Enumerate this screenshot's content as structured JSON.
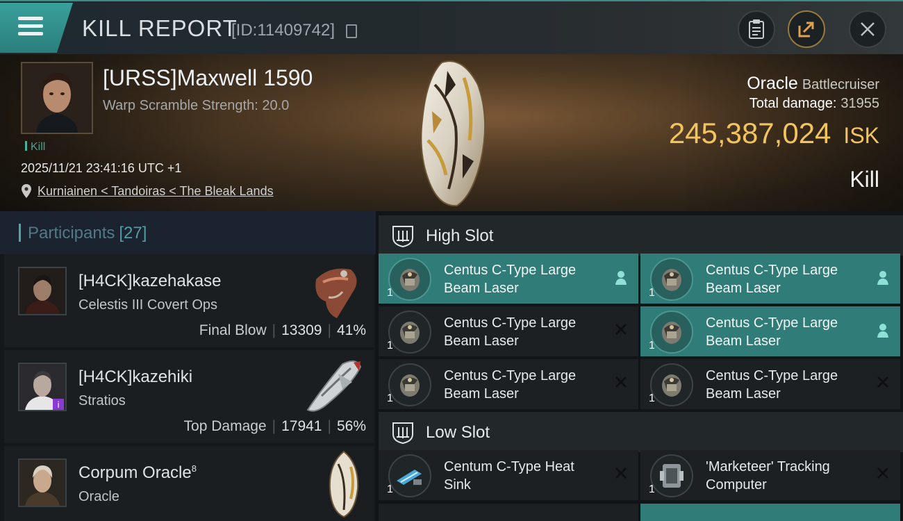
{
  "header": {
    "title": "KILL REPORT",
    "id_text": "[ID:11409742]"
  },
  "victim": {
    "name": "[URSS]Maxwell 1590",
    "subtitle": "Warp Scramble Strength: 20.0",
    "kill_tag": "Kill",
    "time": "2025/11/21 23:41:16 UTC +1",
    "location": "Kurniainen < Tandoiras < The Bleak Lands",
    "ship_name": "Oracle",
    "ship_class": "Battlecruiser",
    "total_damage_label": "Total damage:",
    "total_damage": "31955",
    "isk_value": "245,387,024",
    "isk_unit": "ISK",
    "result": "Kill"
  },
  "participants": {
    "label": "Participants",
    "count": "[27]",
    "rows": [
      {
        "name": "[H4CK]kazehakase",
        "ship": "Celestis III Covert Ops",
        "stat_label": "Final Blow",
        "damage": "13309",
        "percent": "41%"
      },
      {
        "name": "[H4CK]kazehiki",
        "ship": "Stratios",
        "stat_label": "Top Damage",
        "damage": "17941",
        "percent": "56%"
      },
      {
        "name": "Corpum Oracle",
        "name_sup": "8",
        "ship": "Oracle"
      }
    ]
  },
  "slots": {
    "high": {
      "label": "High Slot",
      "modules": [
        {
          "name": "Centus C-Type Large Beam Laser",
          "qty": "1",
          "status": "dropped"
        },
        {
          "name": "Centus C-Type Large Beam Laser",
          "qty": "1",
          "status": "dropped"
        },
        {
          "name": "Centus C-Type Large Beam Laser",
          "qty": "1",
          "status": "destroyed"
        },
        {
          "name": "Centus C-Type Large Beam Laser",
          "qty": "1",
          "status": "dropped"
        },
        {
          "name": "Centus C-Type Large Beam Laser",
          "qty": "1",
          "status": "destroyed"
        },
        {
          "name": "Centus C-Type Large Beam Laser",
          "qty": "1",
          "status": "destroyed"
        }
      ]
    },
    "low": {
      "label": "Low Slot",
      "modules": [
        {
          "name": "Centum C-Type Heat Sink",
          "qty": "1",
          "status": "destroyed"
        },
        {
          "name": "'Marketeer' Tracking Computer",
          "qty": "1",
          "status": "destroyed"
        }
      ]
    }
  },
  "colors": {
    "accent_teal": "#3aa09b",
    "isk_gold": "#f2c45e",
    "fitted_green": "#2f7c78"
  },
  "icons": [
    "menu-icon",
    "copy-icon",
    "clipboard-icon",
    "share-icon",
    "close-icon",
    "location-pin-icon",
    "slot-icon",
    "pilot-icon",
    "destroyed-x-icon"
  ]
}
